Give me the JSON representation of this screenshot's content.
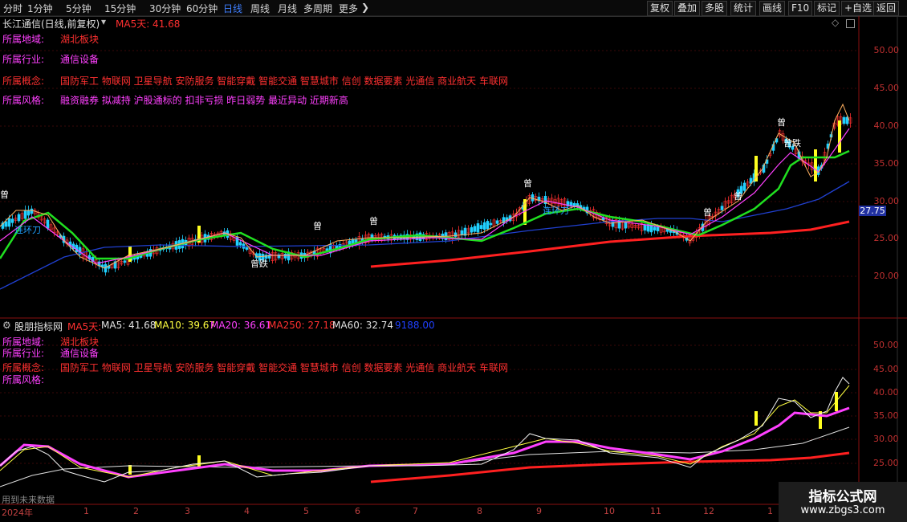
{
  "toolbar": {
    "timeframes": [
      "分时",
      "1分钟",
      "5分钟",
      "15分钟",
      "30分钟",
      "60分钟",
      "日线",
      "周线",
      "月线",
      "多周期",
      "更多"
    ],
    "active_timeframe": "日线",
    "buttons": [
      "复权",
      "叠加",
      "多股",
      "统计",
      "画线",
      "F10",
      "标记",
      "+自选",
      "返回"
    ]
  },
  "main_chart": {
    "title": "长江通信(日线,前复权)",
    "ma_label": "MA5天: 41.68",
    "info": [
      {
        "key": "所属地域:",
        "value": "湖北板块"
      },
      {
        "key": "所属行业:",
        "value": "通信设备"
      },
      {
        "key": "所属概念:",
        "value": "国防军工 物联网 卫星导航 安防服务 智能穿戴 智能交通 智慧城市 信创 数据要素 光通信 商业航天 车联网"
      },
      {
        "key": "所属风格:",
        "value": "融资融券 拟减持 沪股通标的 扣非亏损 昨日弱势 最近异动 近期新高"
      }
    ],
    "y_ticks": [
      "50.00",
      "45.00",
      "40.00",
      "35.00",
      "30.00",
      "25.00",
      "20.00"
    ],
    "price_tag": "27.75",
    "markers": [
      "曾",
      "曾跌",
      "曾",
      "曾",
      "曾",
      "曾",
      "曾跌",
      "曾",
      "曾",
      "连环刀",
      "连环刀"
    ]
  },
  "sub_chart": {
    "title": "股朋指标网",
    "legend": [
      {
        "text": "MA5天:",
        "color": "#ff3030"
      },
      {
        "text": "MA5: 41.68",
        "color": "#e0e0e0"
      },
      {
        "text": "MA10: 39.67",
        "color": "#ffff40"
      },
      {
        "text": "MA20: 36.61",
        "color": "#ff40ff"
      },
      {
        "text": "MA250: 27.18",
        "color": "#ff3030"
      },
      {
        "text": "MA60: 32.74",
        "color": "#e0e0e0"
      },
      {
        "text": "9188.00",
        "color": "#2040ff"
      }
    ],
    "info": [
      {
        "key": "所属地域:",
        "value": "湖北板块"
      },
      {
        "key": "所属行业:",
        "value": "通信设备"
      },
      {
        "key": "所属概念:",
        "value": "国防军工 物联网 卫星导航 安防服务 智能穿戴 智能交通 智慧城市 信创 数据要素 光通信 商业航天 车联网"
      },
      {
        "key": "所属风格:",
        "value": ""
      }
    ],
    "y_ticks": [
      "50.00",
      "45.00",
      "40.00",
      "35.00",
      "30.00",
      "25.00"
    ],
    "footer": "用到未来数据"
  },
  "x_axis": [
    "2024年",
    "1",
    "2",
    "3",
    "4",
    "5",
    "6",
    "7",
    "8",
    "9",
    "10",
    "11",
    "12",
    "1"
  ],
  "watermark": {
    "line1": "指标公式网",
    "line2": "www.zbgs3.com"
  },
  "colors": {
    "ma5": "#ff3030",
    "ma10": "#ffff40",
    "ma20": "#ff40ff",
    "green": "#20e020",
    "ma60": "#2040d0",
    "ma250": "#ff2020",
    "up": "#ff3030",
    "down": "#20d0ff"
  }
}
